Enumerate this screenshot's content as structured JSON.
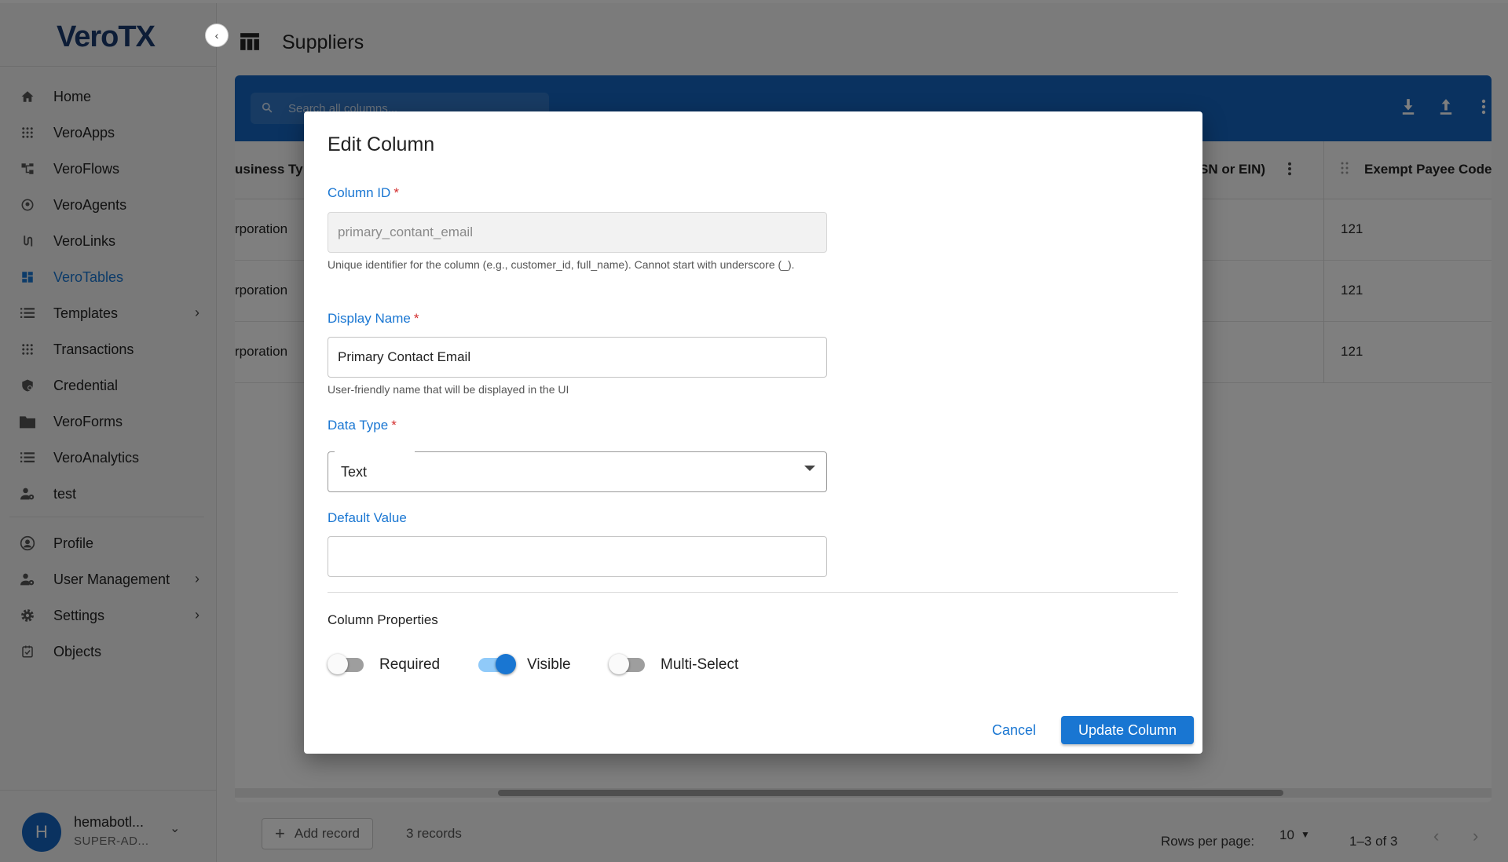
{
  "app": {
    "logo": "VeroTX",
    "page_title": "Suppliers"
  },
  "sidebar": {
    "items": [
      {
        "label": "Home",
        "icon": "home-icon"
      },
      {
        "label": "VeroApps",
        "icon": "apps-grid-icon"
      },
      {
        "label": "VeroFlows",
        "icon": "flow-icon"
      },
      {
        "label": "VeroAgents",
        "icon": "agent-icon"
      },
      {
        "label": "VeroLinks",
        "icon": "link-icon"
      },
      {
        "label": "VeroTables",
        "icon": "dashboard-icon",
        "active": true
      },
      {
        "label": "Templates",
        "icon": "list-icon",
        "has_children": true
      },
      {
        "label": "Transactions",
        "icon": "apps-grid-icon"
      },
      {
        "label": "Credential",
        "icon": "credential-icon"
      },
      {
        "label": "VeroForms",
        "icon": "folder-icon"
      },
      {
        "label": "VeroAnalytics",
        "icon": "list-icon"
      },
      {
        "label": "test",
        "icon": "user-gear-icon"
      }
    ],
    "bottom_items": [
      {
        "label": "Profile",
        "icon": "profile-icon"
      },
      {
        "label": "User Management",
        "icon": "user-gear-icon",
        "has_children": true
      },
      {
        "label": "Settings",
        "icon": "gear-icon",
        "has_children": true
      },
      {
        "label": "Objects",
        "icon": "objects-icon"
      }
    ],
    "user": {
      "initial": "H",
      "name": "hemabotl...",
      "role": "SUPER-AD..."
    }
  },
  "table": {
    "search_placeholder": "Search all columns...",
    "headers": [
      "usiness Ty",
      "SN or EIN)",
      "Exempt Payee Code"
    ],
    "rows": [
      [
        "rporation",
        "121"
      ],
      [
        "rporation",
        "121"
      ],
      [
        "rporation",
        "121"
      ]
    ],
    "add_record_label": "Add record",
    "records_count": "3 records",
    "rows_per_page_label": "Rows per page:",
    "rows_per_page_value": "10",
    "page_range": "1–3 of 3"
  },
  "dialog": {
    "title": "Edit Column",
    "column_id": {
      "label": "Column ID",
      "value": "primary_contant_email",
      "helper": "Unique identifier for the column (e.g., customer_id, full_name). Cannot start with underscore (_)."
    },
    "display_name": {
      "label": "Display Name",
      "value": "Primary Contact Email",
      "helper": "User-friendly name that will be displayed in the UI"
    },
    "data_type": {
      "label": "Data Type",
      "value": "Text"
    },
    "default_value": {
      "label": "Default Value",
      "value": ""
    },
    "required_marker": "*",
    "properties_title": "Column Properties",
    "toggles": [
      {
        "label": "Required",
        "on": false
      },
      {
        "label": "Visible",
        "on": true
      },
      {
        "label": "Multi-Select",
        "on": false
      }
    ],
    "cancel_label": "Cancel",
    "update_label": "Update Column"
  },
  "colors": {
    "primary": "#1976d2",
    "toolbar": "#1565c0",
    "required": "#d32f2f",
    "overlay": "rgba(0,0,0,0.5)"
  }
}
